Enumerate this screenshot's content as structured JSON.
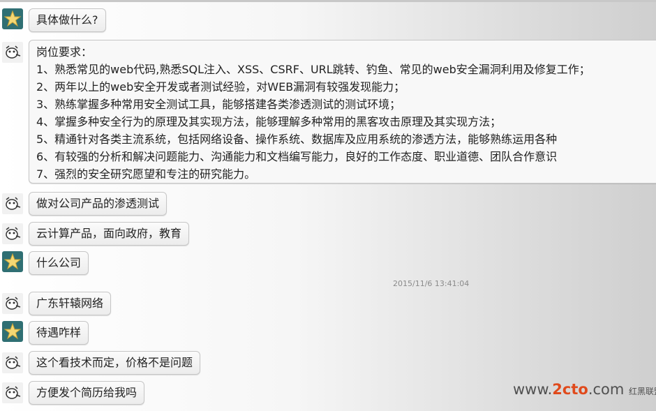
{
  "conversation": {
    "messages": [
      {
        "sender": "me",
        "text": "具体做什么?"
      },
      {
        "sender": "other",
        "lines": [
          "岗位要求：",
          "1、熟悉常见的web代码,熟悉SQL注入、XSS、CSRF、URL跳转、钓鱼、常见的web安全漏洞利用及修复工作；",
          "2、两年以上的web安全开发或者测试经验，对WEB漏洞有较强发现能力；",
          "3、熟练掌握多种常用安全测试工具，能够搭建各类渗透测试的测试环境；",
          "4、掌握多种安全行为的原理及其实现方法，能够理解多种常用的黑客攻击原理及其实现方法；",
          "5、精通针对各类主流系统，包括网络设备、操作系统、数据库及应用系统的渗透方法，能够熟练运用各种",
          "6、有较强的分析和解决问题能力、沟通能力和文档编写能力，良好的工作态度、职业道德、团队合作意识",
          "7、强烈的安全研究愿望和专注的研究能力。"
        ]
      },
      {
        "sender": "other",
        "text": "做对公司产品的渗透测试"
      },
      {
        "sender": "other",
        "text": "云计算产品，面向政府，教育"
      },
      {
        "sender": "me",
        "text": "什么公司"
      },
      {
        "sender": "other",
        "text": "广东轩辕网络"
      },
      {
        "sender": "me",
        "text": "待遇咋样"
      },
      {
        "sender": "other",
        "text": "这个看技术而定，价格不是问题"
      },
      {
        "sender": "other",
        "text": "方便发个简历给我吗"
      }
    ],
    "timestamp": "2015/11/6 13:41:04"
  },
  "watermark": {
    "prefix": "www.",
    "brand": "2cto",
    "suffix": ".com",
    "small": "红黑联盟"
  },
  "icons": {
    "me_avatar": "star-avatar-icon",
    "other_avatar": "cartoon-avatar-icon"
  }
}
